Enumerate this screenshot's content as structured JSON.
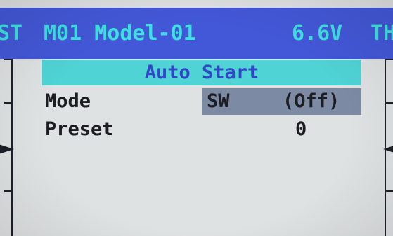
{
  "header": {
    "left_trim_label": "ST",
    "model": "M01 Model-01",
    "voltage": "6.6V",
    "right_trim_label": "TH",
    "background_color": "#4358d8",
    "text_color": "#3fe0e2"
  },
  "screen": {
    "title": "Auto Start",
    "title_bar_color": "#4fd3d5"
  },
  "rows": {
    "mode": {
      "label": "Mode",
      "switch": "SW",
      "state": "(Off)",
      "highlight_color": "#7d8aa4"
    },
    "preset": {
      "label": "Preset",
      "value": "0"
    }
  }
}
